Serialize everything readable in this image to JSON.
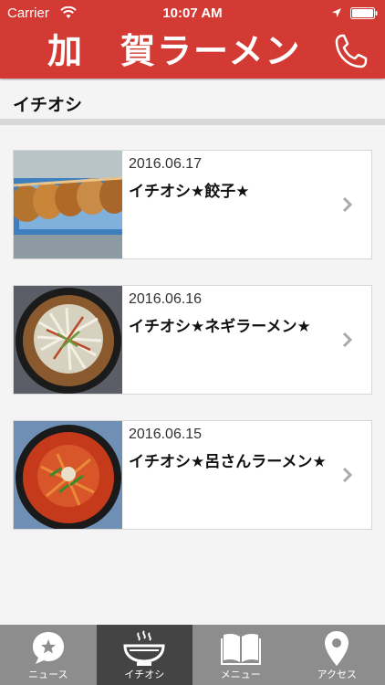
{
  "status_bar": {
    "carrier": "Carrier",
    "time": "10:07 AM"
  },
  "header": {
    "title": "加　賀ラーメン",
    "brand_color": "#d23a33",
    "phone_icon": "phone-icon"
  },
  "section": {
    "title": "イチオシ"
  },
  "items": [
    {
      "date": "2016.06.17",
      "title": "イチオシ★餃子★",
      "image": "gyoza-photo"
    },
    {
      "date": "2016.06.16",
      "title": "イチオシ★ネギラーメン★",
      "image": "negi-ramen-photo"
    },
    {
      "date": "2016.06.15",
      "title": "イチオシ★呂さんラーメン★",
      "image": "ro-san-ramen-photo"
    }
  ],
  "tabs": [
    {
      "label": "ニュース",
      "icon": "news-bubble-icon",
      "active": false
    },
    {
      "label": "イチオシ",
      "icon": "bowl-icon",
      "active": true
    },
    {
      "label": "メニュー",
      "icon": "book-icon",
      "active": false
    },
    {
      "label": "アクセス",
      "icon": "map-pin-icon",
      "active": false
    }
  ],
  "colors": {
    "tabbar": "#8d8d8d",
    "tab_active": "#444444",
    "background": "#f4f4f4"
  }
}
